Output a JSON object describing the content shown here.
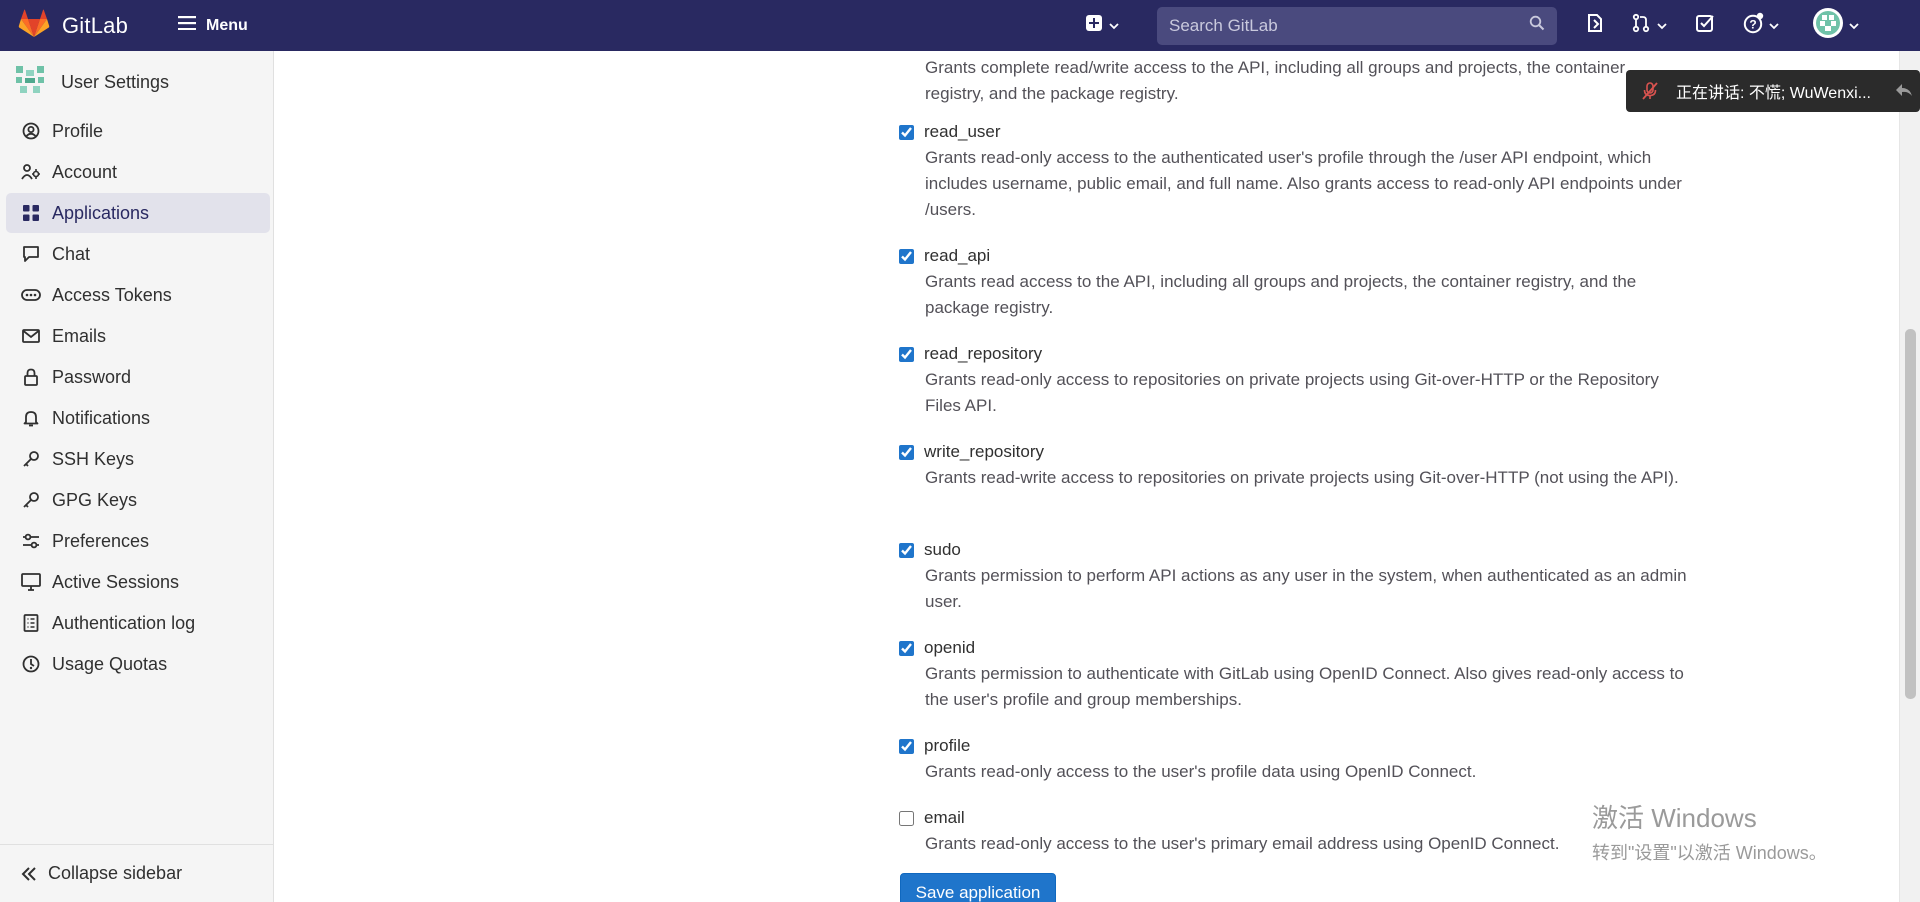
{
  "topbar": {
    "brand": "GitLab",
    "menu_label": "Menu",
    "search_placeholder": "Search GitLab"
  },
  "sidebar": {
    "title": "User Settings",
    "items": [
      {
        "label": "Profile",
        "icon": "profile-icon"
      },
      {
        "label": "Account",
        "icon": "account-icon"
      },
      {
        "label": "Applications",
        "icon": "applications-icon",
        "active": true
      },
      {
        "label": "Chat",
        "icon": "chat-icon"
      },
      {
        "label": "Access Tokens",
        "icon": "token-icon"
      },
      {
        "label": "Emails",
        "icon": "mail-icon"
      },
      {
        "label": "Password",
        "icon": "lock-icon"
      },
      {
        "label": "Notifications",
        "icon": "bell-icon"
      },
      {
        "label": "SSH Keys",
        "icon": "key-icon"
      },
      {
        "label": "GPG Keys",
        "icon": "key-icon"
      },
      {
        "label": "Preferences",
        "icon": "preferences-icon"
      },
      {
        "label": "Active Sessions",
        "icon": "monitor-icon"
      },
      {
        "label": "Authentication log",
        "icon": "log-icon"
      },
      {
        "label": "Usage Quotas",
        "icon": "quota-icon"
      }
    ],
    "collapse_label": "Collapse sidebar"
  },
  "main": {
    "top_fragment": "Grants complete read/write access to the API, including all groups and projects, the container registry, and the package registry.",
    "scopes": [
      {
        "name": "read_user",
        "checked": true,
        "desc": "Grants read-only access to the authenticated user's profile through the /user API endpoint, which includes username, public email, and full name. Also grants access to read-only API endpoints under /users."
      },
      {
        "name": "read_api",
        "checked": true,
        "desc": "Grants read access to the API, including all groups and projects, the container registry, and the package registry."
      },
      {
        "name": "read_repository",
        "checked": true,
        "desc": "Grants read-only access to repositories on private projects using Git-over-HTTP or the Repository Files API."
      },
      {
        "name": "write_repository",
        "checked": true,
        "desc": "Grants read-write access to repositories on private projects using Git-over-HTTP (not using the API)."
      },
      {
        "name": "sudo",
        "checked": true,
        "desc": "Grants permission to perform API actions as any user in the system, when authenticated as an admin user."
      },
      {
        "name": "openid",
        "checked": true,
        "desc": "Grants permission to authenticate with GitLab using OpenID Connect. Also gives read-only access to the user's profile and group memberships."
      },
      {
        "name": "profile",
        "checked": true,
        "desc": "Grants read-only access to the user's profile data using OpenID Connect."
      },
      {
        "name": "email",
        "checked": false,
        "desc": "Grants read-only access to the user's primary email address using OpenID Connect."
      }
    ],
    "save_button": "Save application"
  },
  "overlay": {
    "speaking_text": "正在讲话: 不慌; WuWenxi..."
  },
  "watermark": {
    "line1": "激活 Windows",
    "line2": "转到\"设置\"以激活 Windows。"
  },
  "colors": {
    "topbar_bg": "#292961",
    "primary_button": "#1f75cb",
    "active_nav_bg": "#e2e2eb"
  }
}
